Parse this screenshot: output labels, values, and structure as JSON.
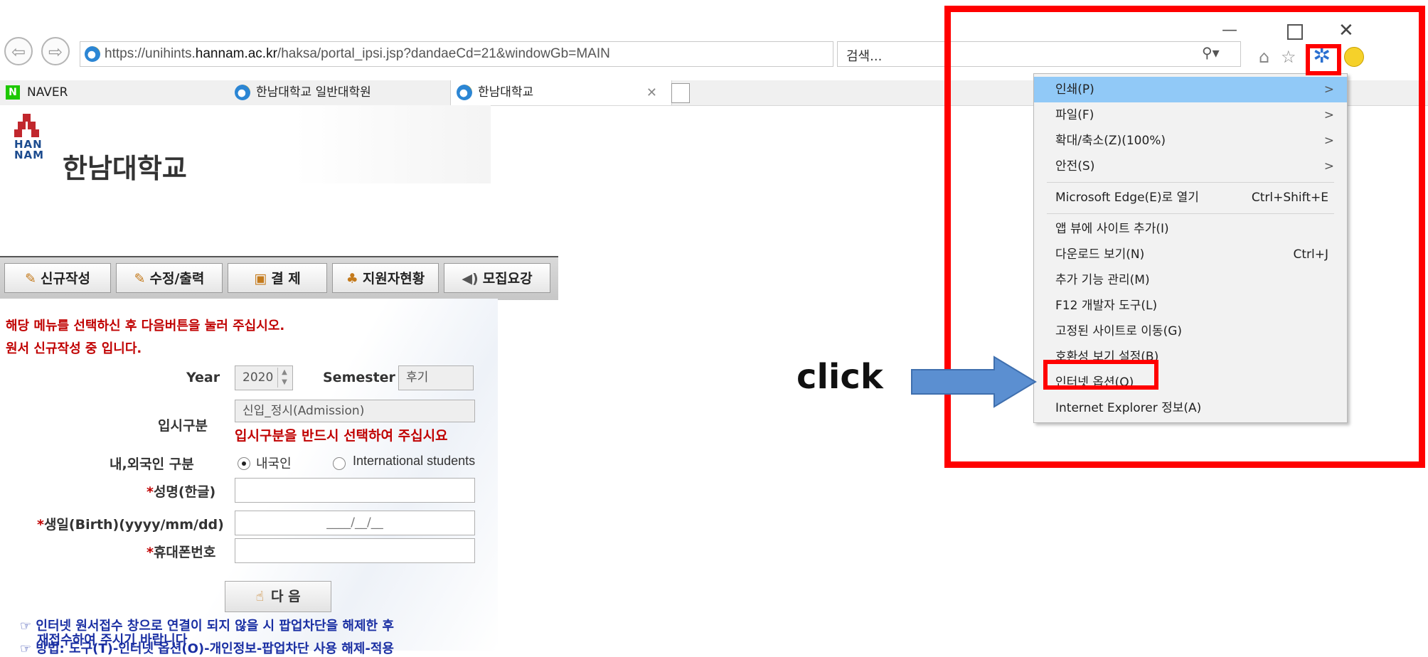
{
  "browser": {
    "url_prefix": "https://unihints.",
    "url_domain": "hannam.ac.kr",
    "url_path": "/haksa/portal_ipsi.jsp?dandaeCd=21&windowGb=MAIN",
    "search_placeholder": "검색...",
    "tabs": [
      {
        "label": "NAVER",
        "badge": "N"
      },
      {
        "label": "한남대학교 일반대학원"
      },
      {
        "label": "한남대학교"
      }
    ]
  },
  "page": {
    "logo_text": "한남대학교",
    "logo_mark_top": "HAN",
    "logo_mark_bottom": "NAM",
    "menu_buttons": [
      "신규작성",
      "수정/출력",
      "결  제",
      "지원자현황",
      "모집요강"
    ],
    "notice1": "해당 메뉴를 선택하신 후 다음버튼을 눌러 주십시오.",
    "notice2": "원서 신규작성 중 입니다.",
    "year_label": "Year",
    "year_value": "2020",
    "semester_label": "Semester",
    "semester_value": "후기",
    "admission_label": "입시구분",
    "admission_value": "신입_정시(Admission)",
    "admission_warning": "입시구분을 반드시 선택하여 주십시요",
    "nationality_label": "내,외국인 구분",
    "nationality_options": [
      "내국인",
      "International students"
    ],
    "name_label": "성명(한글)",
    "birth_label": "생일(Birth)(yyyy/mm/dd)",
    "birth_mask": "____/__/__",
    "phone_label": "휴대폰번호",
    "next_button": "다  음",
    "info1_line1": "인터넷 원서접수 창으로 연결이 되지 않을 시 팝업차단을 해제한 후",
    "info1_line2": "재접수하여 주시기 바랍니다",
    "info2": "방법: 도구(T)-인터넷 옵션(O)-개인정보-팝업차단 사용 해제-적용"
  },
  "tools_menu": {
    "items": [
      {
        "label": "인쇄(P)",
        "arrow": ">"
      },
      {
        "label": "파일(F)",
        "arrow": ">"
      },
      {
        "label": "확대/축소(Z)(100%)",
        "arrow": ">"
      },
      {
        "label": "안전(S)",
        "arrow": ">"
      },
      {
        "label": "Microsoft Edge(E)로 열기",
        "shortcut": "Ctrl+Shift+E"
      },
      {
        "label": "앱 뷰에 사이트 추가(I)"
      },
      {
        "label": "다운로드 보기(N)",
        "shortcut": "Ctrl+J"
      },
      {
        "label": "추가 기능 관리(M)"
      },
      {
        "label": "F12 개발자 도구(L)"
      },
      {
        "label": "고정된 사이트로 이동(G)"
      },
      {
        "label": "호환성 보기 설정(B)"
      },
      {
        "label": "인터넷 옵션(O)"
      },
      {
        "label": "Internet Explorer 정보(A)"
      }
    ]
  },
  "annotation": {
    "click_label": "click"
  },
  "colors": {
    "highlight": "#ff0000",
    "menu_hover": "#91c9f7",
    "arrow": "#5b8fd1",
    "notice_red": "#c00000",
    "info_blue": "#1a2fa3"
  }
}
